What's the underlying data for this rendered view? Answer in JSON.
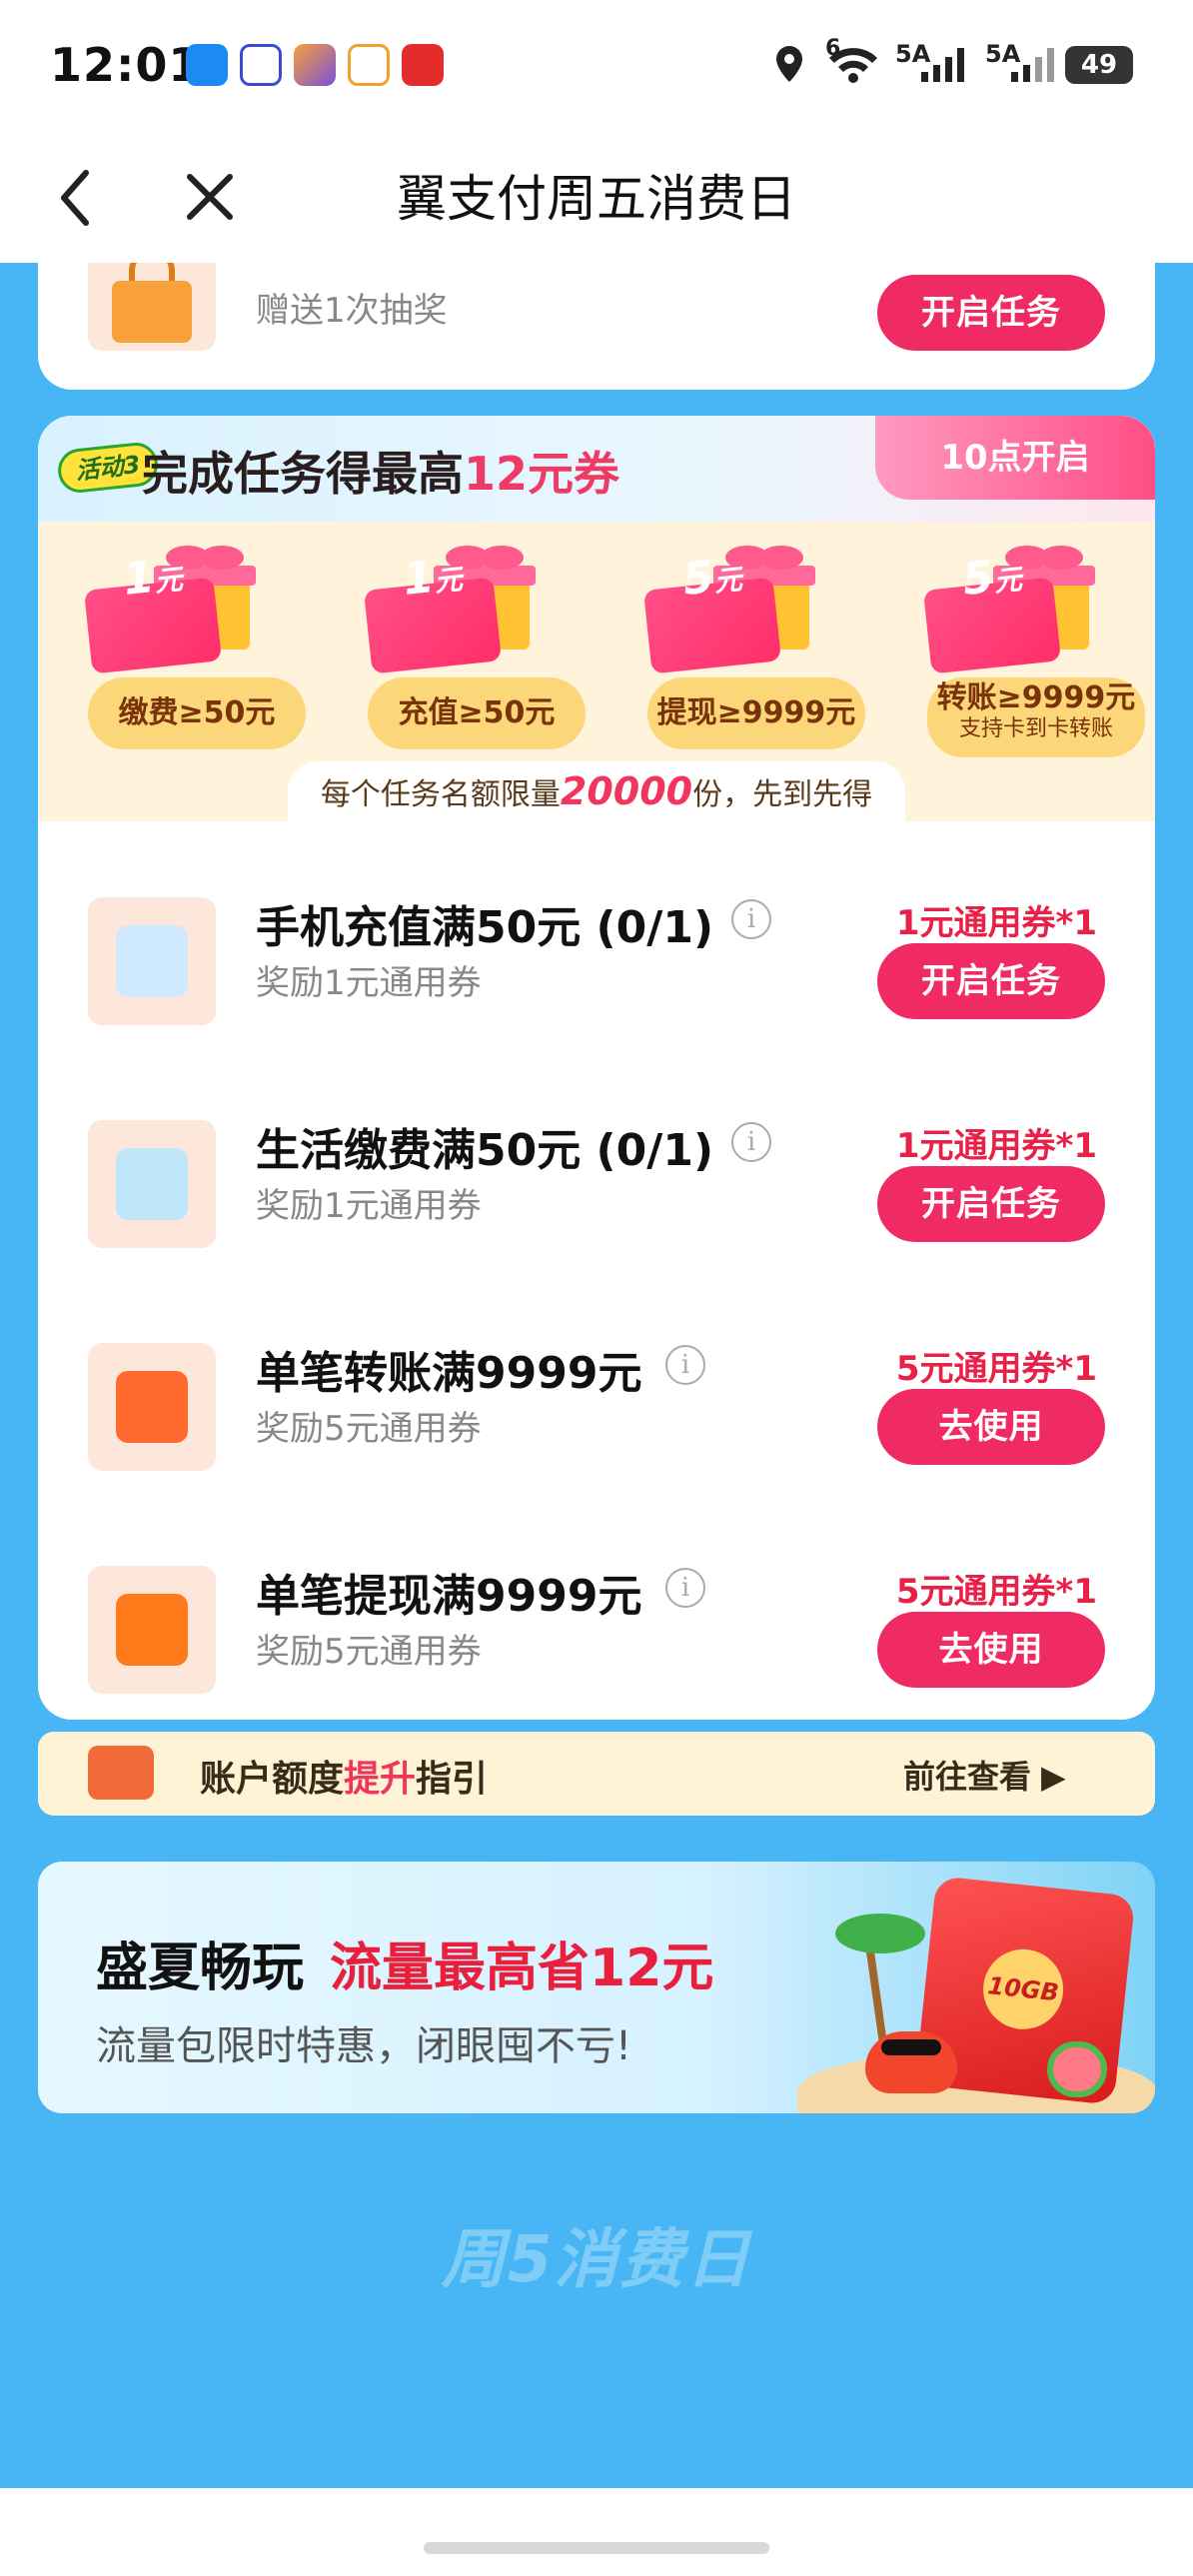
{
  "status_bar": {
    "time": "12:01",
    "network_1": "6",
    "network_2": "5A",
    "network_3": "5A",
    "battery": "49"
  },
  "nav": {
    "title": "翼支付周五消费日",
    "back_icon": "chevron-left-icon",
    "close_icon": "close-icon"
  },
  "top_card": {
    "subtitle": "赠送1次抽奖",
    "button": "开启任务"
  },
  "activity3": {
    "badge": "活动3",
    "title_prefix": "完成任务得最高",
    "title_highlight": "12元券",
    "time_tag": "10点开启",
    "prizes": [
      {
        "amount": "1",
        "unit": "元",
        "label": "缴费≥50元",
        "note": ""
      },
      {
        "amount": "1",
        "unit": "元",
        "label": "充值≥50元",
        "note": ""
      },
      {
        "amount": "5",
        "unit": "元",
        "label": "提现≥9999元",
        "note": ""
      },
      {
        "amount": "5",
        "unit": "元",
        "label": "转账≥9999元",
        "note": "支持卡到卡转账"
      }
    ],
    "quota_prefix": "每个任务名额限量",
    "quota_number": "20000",
    "quota_suffix": "份，先到先得"
  },
  "tasks": [
    {
      "title": "手机充值满50元 (0/1)",
      "sub": "奖励1元通用券",
      "reward": "1元通用券*1",
      "button": "开启任务",
      "icon": "phone-topup-icon"
    },
    {
      "title": "生活缴费满50元 (0/1)",
      "sub": "奖励1元通用券",
      "reward": "1元通用券*1",
      "button": "开启任务",
      "icon": "bill-icon"
    },
    {
      "title": "单笔转账满9999元",
      "sub": "奖励5元通用券",
      "reward": "5元通用券*1",
      "button": "去使用",
      "icon": "wallet-icon"
    },
    {
      "title": "单笔提现满9999元",
      "sub": "奖励5元通用券",
      "reward": "5元通用券*1",
      "button": "去使用",
      "icon": "withdraw-icon"
    }
  ],
  "guide_banner": {
    "text_prefix": "账户额度",
    "text_highlight": "提升",
    "text_suffix": "指引",
    "link": "前往查看"
  },
  "promo_banner": {
    "title_a": "盛夏畅玩",
    "title_b": "流量最高省12元",
    "subtitle": "流量包限时特惠，闭眼囤不亏!",
    "envelope_text": "10GB"
  },
  "footer_logo": "周5消费日",
  "colors": {
    "page_bg": "#48b6f5",
    "accent": "#f02b63",
    "reward_red": "#e82148"
  }
}
